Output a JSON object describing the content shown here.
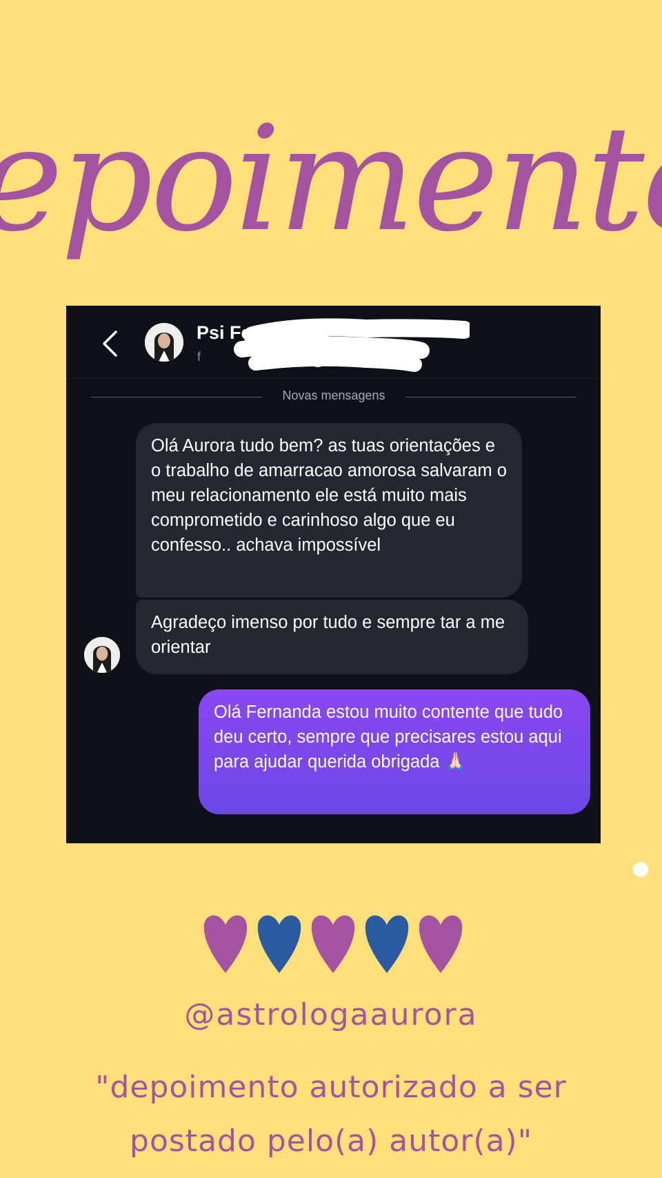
{
  "title": "Depoimentos",
  "chat": {
    "contact_name": "Psi Fe",
    "contact_sub": "f",
    "divider_label": "Novas mensagens",
    "messages": [
      {
        "text": "Olá Aurora tudo bem? as tuas orientações e o trabalho de amarracao amorosa salvaram o meu relacionamento ele está muito mais comprometido e carinhoso algo que eu confesso.. achava impossível"
      },
      {
        "text": "Agradeço imenso por tudo e sempre tar a me orientar"
      },
      {
        "text": "Olá Fernanda estou muito contente que tudo deu certo, sempre que precisares estou aqui para ajudar querida obrigada 🙏🏻"
      }
    ]
  },
  "hearts": [
    "#a453a1",
    "#2a5ba1",
    "#a453a1",
    "#2a5ba1",
    "#a453a1"
  ],
  "colors": {
    "background": "#fde07a",
    "accent": "#a453a1",
    "chat_background": "#0d1016",
    "incoming_bubble": "#25272e",
    "outgoing_bubble": "#7a47ee"
  },
  "footer": {
    "handle": "@astrologaaurora",
    "disclaimer_line1": "\"depoimento autorizado a ser",
    "disclaimer_line2": "postado pelo(a) autor(a)\""
  }
}
